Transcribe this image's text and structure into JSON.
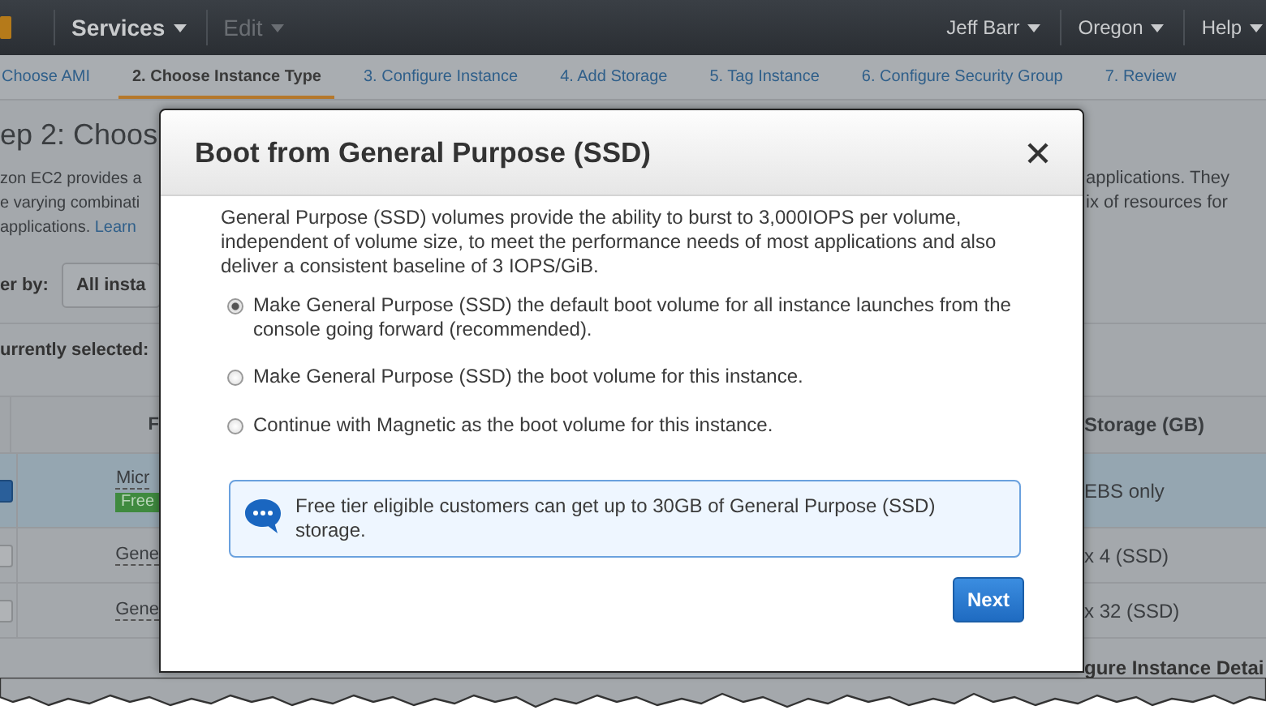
{
  "nav": {
    "left": [
      {
        "label": "Services",
        "disabled": false
      },
      {
        "label": "Edit",
        "disabled": true
      }
    ],
    "right": [
      {
        "label": "Jeff Barr"
      },
      {
        "label": "Oregon"
      },
      {
        "label": "Help"
      }
    ]
  },
  "steps": [
    {
      "label": "Choose AMI",
      "selected": false
    },
    {
      "label": "2. Choose Instance Type",
      "selected": true
    },
    {
      "label": "3. Configure Instance",
      "selected": false
    },
    {
      "label": "4. Add Storage",
      "selected": false
    },
    {
      "label": "5. Tag Instance",
      "selected": false
    },
    {
      "label": "6. Configure Security Group",
      "selected": false
    },
    {
      "label": "7. Review",
      "selected": false
    }
  ],
  "page": {
    "title": "ep 2: Choos",
    "description_left": [
      "zon EC2 provides a",
      "e varying combinati",
      "applications."
    ],
    "learn_link": "Learn",
    "description_right": [
      "applications. They",
      "ix of resources for"
    ],
    "filter_label": "er by:",
    "filter_value": "All insta",
    "selected_label": "urrently selected:"
  },
  "table": {
    "columns": [
      {
        "label": "F"
      },
      {
        "label": "Storage (GB)"
      }
    ],
    "rows": [
      {
        "selected": true,
        "column_1": "Micr",
        "badge": "Free",
        "column_2": "EBS only"
      },
      {
        "selected": false,
        "column_1": "Gene",
        "column_2": "x 4 (SSD)"
      },
      {
        "selected": false,
        "column_1": "Gene",
        "column_2": "x 32 (SSD)"
      }
    ]
  },
  "footer_button": "gure Instance Detai",
  "modal": {
    "title": "Boot from General Purpose (SSD)",
    "body": "General Purpose (SSD) volumes provide the ability to burst to 3,000IOPS per volume, independent of volume size, to meet the performance needs of most applications and also deliver a consistent baseline of 3 IOPS/GiB.",
    "options": [
      {
        "label": "Make General Purpose (SSD) the default boot volume for all instance launches from the console going forward (recommended).",
        "selected": true
      },
      {
        "label": "Make General Purpose (SSD) the boot volume for this instance.",
        "selected": false
      },
      {
        "label": "Continue with Magnetic as the boot volume for this instance.",
        "selected": false
      }
    ],
    "info": "Free tier eligible customers can get up to 30GB of General Purpose (SSD) storage.",
    "next": "Next"
  }
}
